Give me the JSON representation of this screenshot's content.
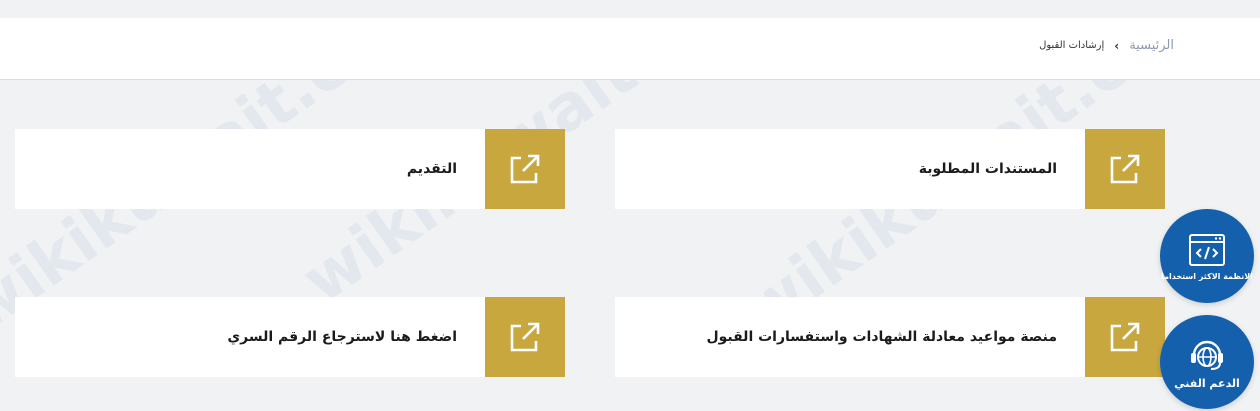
{
  "breadcrumb": {
    "home": "الرئيسية",
    "separator": "›",
    "current": "إرشادات القبول"
  },
  "cards": [
    {
      "label": "المستندات المطلوبة",
      "icon": "external-link-icon"
    },
    {
      "label": "التقديم",
      "icon": "external-link-icon"
    },
    {
      "label": "منصة مواعيد معادلة الشهادات واستفسارات القبول",
      "icon": "external-link-icon"
    },
    {
      "label": "اضغط هنا لاسترجاع الرقم السري",
      "icon": "external-link-icon"
    }
  ],
  "floating": {
    "most_used_label": "الانظمة الاكثر استخداما",
    "support_label": "الدعم الفني"
  },
  "watermark": "wikikuwait.com",
  "colors": {
    "accent_gold": "#c8a73f",
    "floating_blue": "#1560ad",
    "breadcrumb_home": "#8a9bb3"
  }
}
